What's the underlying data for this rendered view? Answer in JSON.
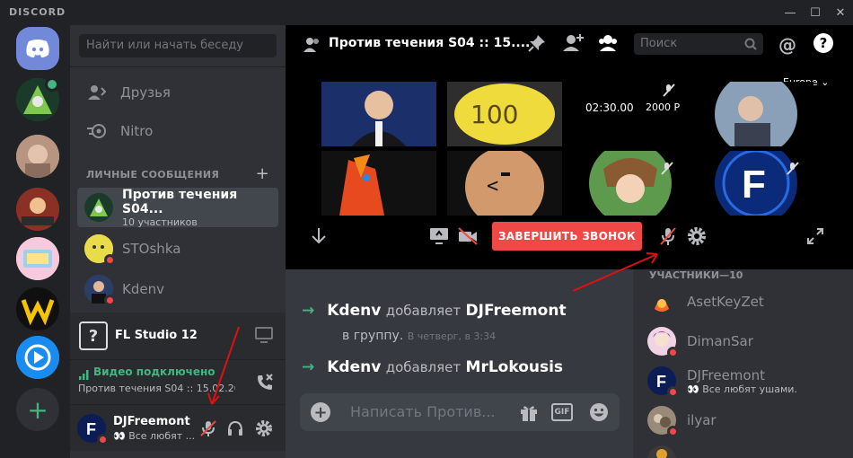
{
  "app": {
    "brand": "DISCORD"
  },
  "window": {
    "minimize": "—",
    "maximize": "☐",
    "close": "✕"
  },
  "sidebar": {
    "search_placeholder": "Найти или начать беседу",
    "nav": [
      {
        "label": "Друзья"
      },
      {
        "label": "Nitro"
      }
    ],
    "dm_header": "ЛИЧНЫЕ СООБЩЕНИЯ",
    "dms": [
      {
        "name": "Против течения S04...",
        "sub": "10 участников",
        "active": true
      },
      {
        "name": "STOshka"
      },
      {
        "name": "Kdenv"
      }
    ],
    "activity": {
      "title": "FL Studio 12"
    },
    "voice": {
      "status": "Видео подключено",
      "channel": "Против течения S04 :: 15.02.20:00..."
    },
    "user": {
      "name": "DJFreemont",
      "status": "👀 Все любят ..."
    }
  },
  "call": {
    "title": "Против течения S04 :: 15....",
    "search_placeholder": "Поиск",
    "region": "Europe",
    "end_button": "ЗАВЕРШИТЬ ЗВОНОК",
    "tile_texts": {
      "timer": "02:30.00",
      "label": "2000 P"
    }
  },
  "chat": {
    "messages": [
      {
        "actor": "Kdenv",
        "verb": "добавляет",
        "target": "DJFreemont",
        "tail": "в группу.",
        "time": "В четверг, в 3:34"
      },
      {
        "actor": "Kdenv",
        "verb": "добавляет",
        "target": "MrLokousis"
      }
    ],
    "composer_placeholder": "Написать Против..."
  },
  "members": {
    "header": "УЧАСТНИКИ—10",
    "list": [
      {
        "name": "AsetKeyZet"
      },
      {
        "name": "DimanSar"
      },
      {
        "name": "DJFreemont",
        "sub": "👀 Все любят ушами."
      },
      {
        "name": "ilyar"
      }
    ]
  },
  "colors": {
    "accent": "#7289da",
    "danger": "#f04747",
    "online": "#43b581"
  }
}
